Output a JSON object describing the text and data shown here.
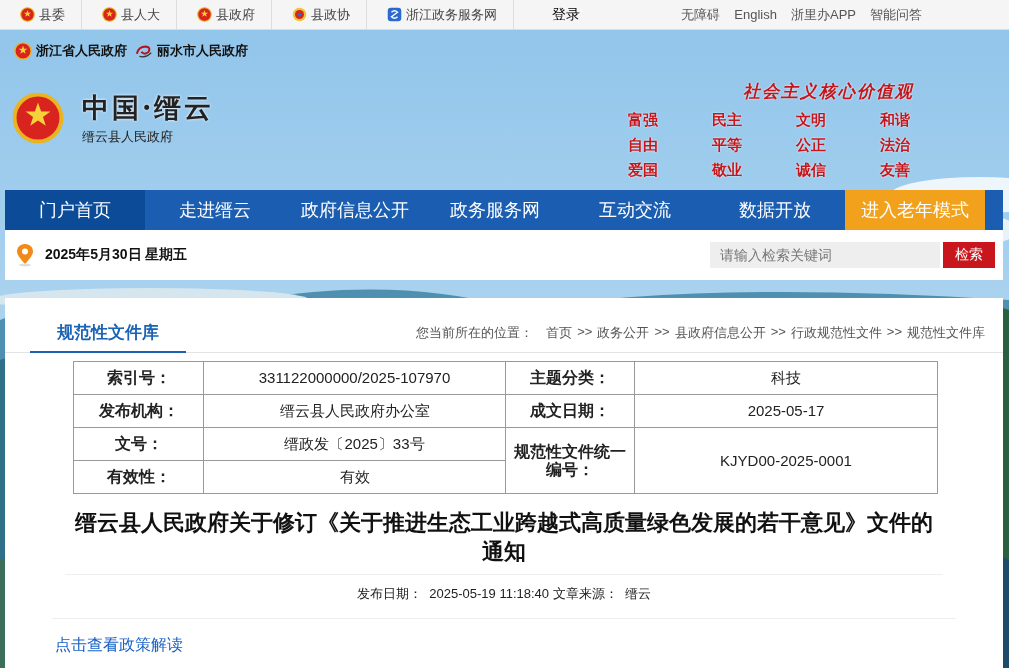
{
  "top_bar": {
    "links": [
      {
        "label": "县委",
        "kind": "emblem"
      },
      {
        "label": "县人大",
        "kind": "emblem"
      },
      {
        "label": "县政府",
        "kind": "emblem"
      },
      {
        "label": "县政协",
        "kind": "cppcc"
      },
      {
        "label": "浙江政务服务网",
        "kind": "service"
      }
    ],
    "login": "登录",
    "right_links": [
      "无障碍",
      "English",
      "浙里办APP",
      "智能问答"
    ]
  },
  "header": {
    "partner_links": [
      {
        "label": "浙江省人民政府",
        "kind": "emblem"
      },
      {
        "label": "丽水市人民政府",
        "kind": "swirl"
      }
    ],
    "site_title": "中国·缙云",
    "site_subtitle": "缙云县人民政府",
    "slogan": "社会主义核心价值观",
    "values": [
      "富强",
      "民主",
      "文明",
      "和谐",
      "自由",
      "平等",
      "公正",
      "法治",
      "爱国",
      "敬业",
      "诚信",
      "友善"
    ]
  },
  "nav": [
    {
      "label": "门户首页",
      "selected": true,
      "kind": "normal"
    },
    {
      "label": "走进缙云",
      "selected": false,
      "kind": "normal"
    },
    {
      "label": "政府信息公开",
      "selected": false,
      "kind": "normal"
    },
    {
      "label": "政务服务网",
      "selected": false,
      "kind": "normal"
    },
    {
      "label": "互动交流",
      "selected": false,
      "kind": "normal"
    },
    {
      "label": "数据开放",
      "selected": false,
      "kind": "normal"
    },
    {
      "label": "进入老年模式",
      "selected": false,
      "kind": "accent"
    }
  ],
  "date_bar": {
    "date": "2025年5月30日 星期五",
    "search": {
      "placeholder": "请输入检索关键词",
      "button": "检索"
    }
  },
  "section_tab": "规范性文件库",
  "breadcrumb": {
    "label": "您当前所在的位置：",
    "items": [
      "首页",
      "政务公开",
      "县政府信息公开",
      "行政规范性文件",
      "规范性文件库"
    ],
    "separators": [
      ">>",
      ">>",
      ">>",
      ">>"
    ]
  },
  "info_table": {
    "left": [
      {
        "label": "索引号：",
        "value": "331122000000/2025-107970"
      },
      {
        "label": "发布机构：",
        "value": "缙云县人民政府办公室"
      },
      {
        "label": "文号：",
        "value": "缙政发〔2025〕33号"
      },
      {
        "label": "有效性：",
        "value": "有效"
      }
    ],
    "right": [
      {
        "label": "主题分类：",
        "value": "科技"
      },
      {
        "label": "成文日期：",
        "value": "2025-05-17"
      },
      {
        "label": "规范性文件统一编号：",
        "value": "KJYD00-2025-0001"
      }
    ]
  },
  "article": {
    "title": "缙云县人民政府关于修订《关于推进生态工业跨越式高质量绿色发展的若干意见》文件的通知",
    "date_label": "发布日期：",
    "date": "2025-05-19 11:18:40",
    "source_label": "文章来源：",
    "source": "缙云",
    "interpretation_link": "点击查看政策解读"
  }
}
